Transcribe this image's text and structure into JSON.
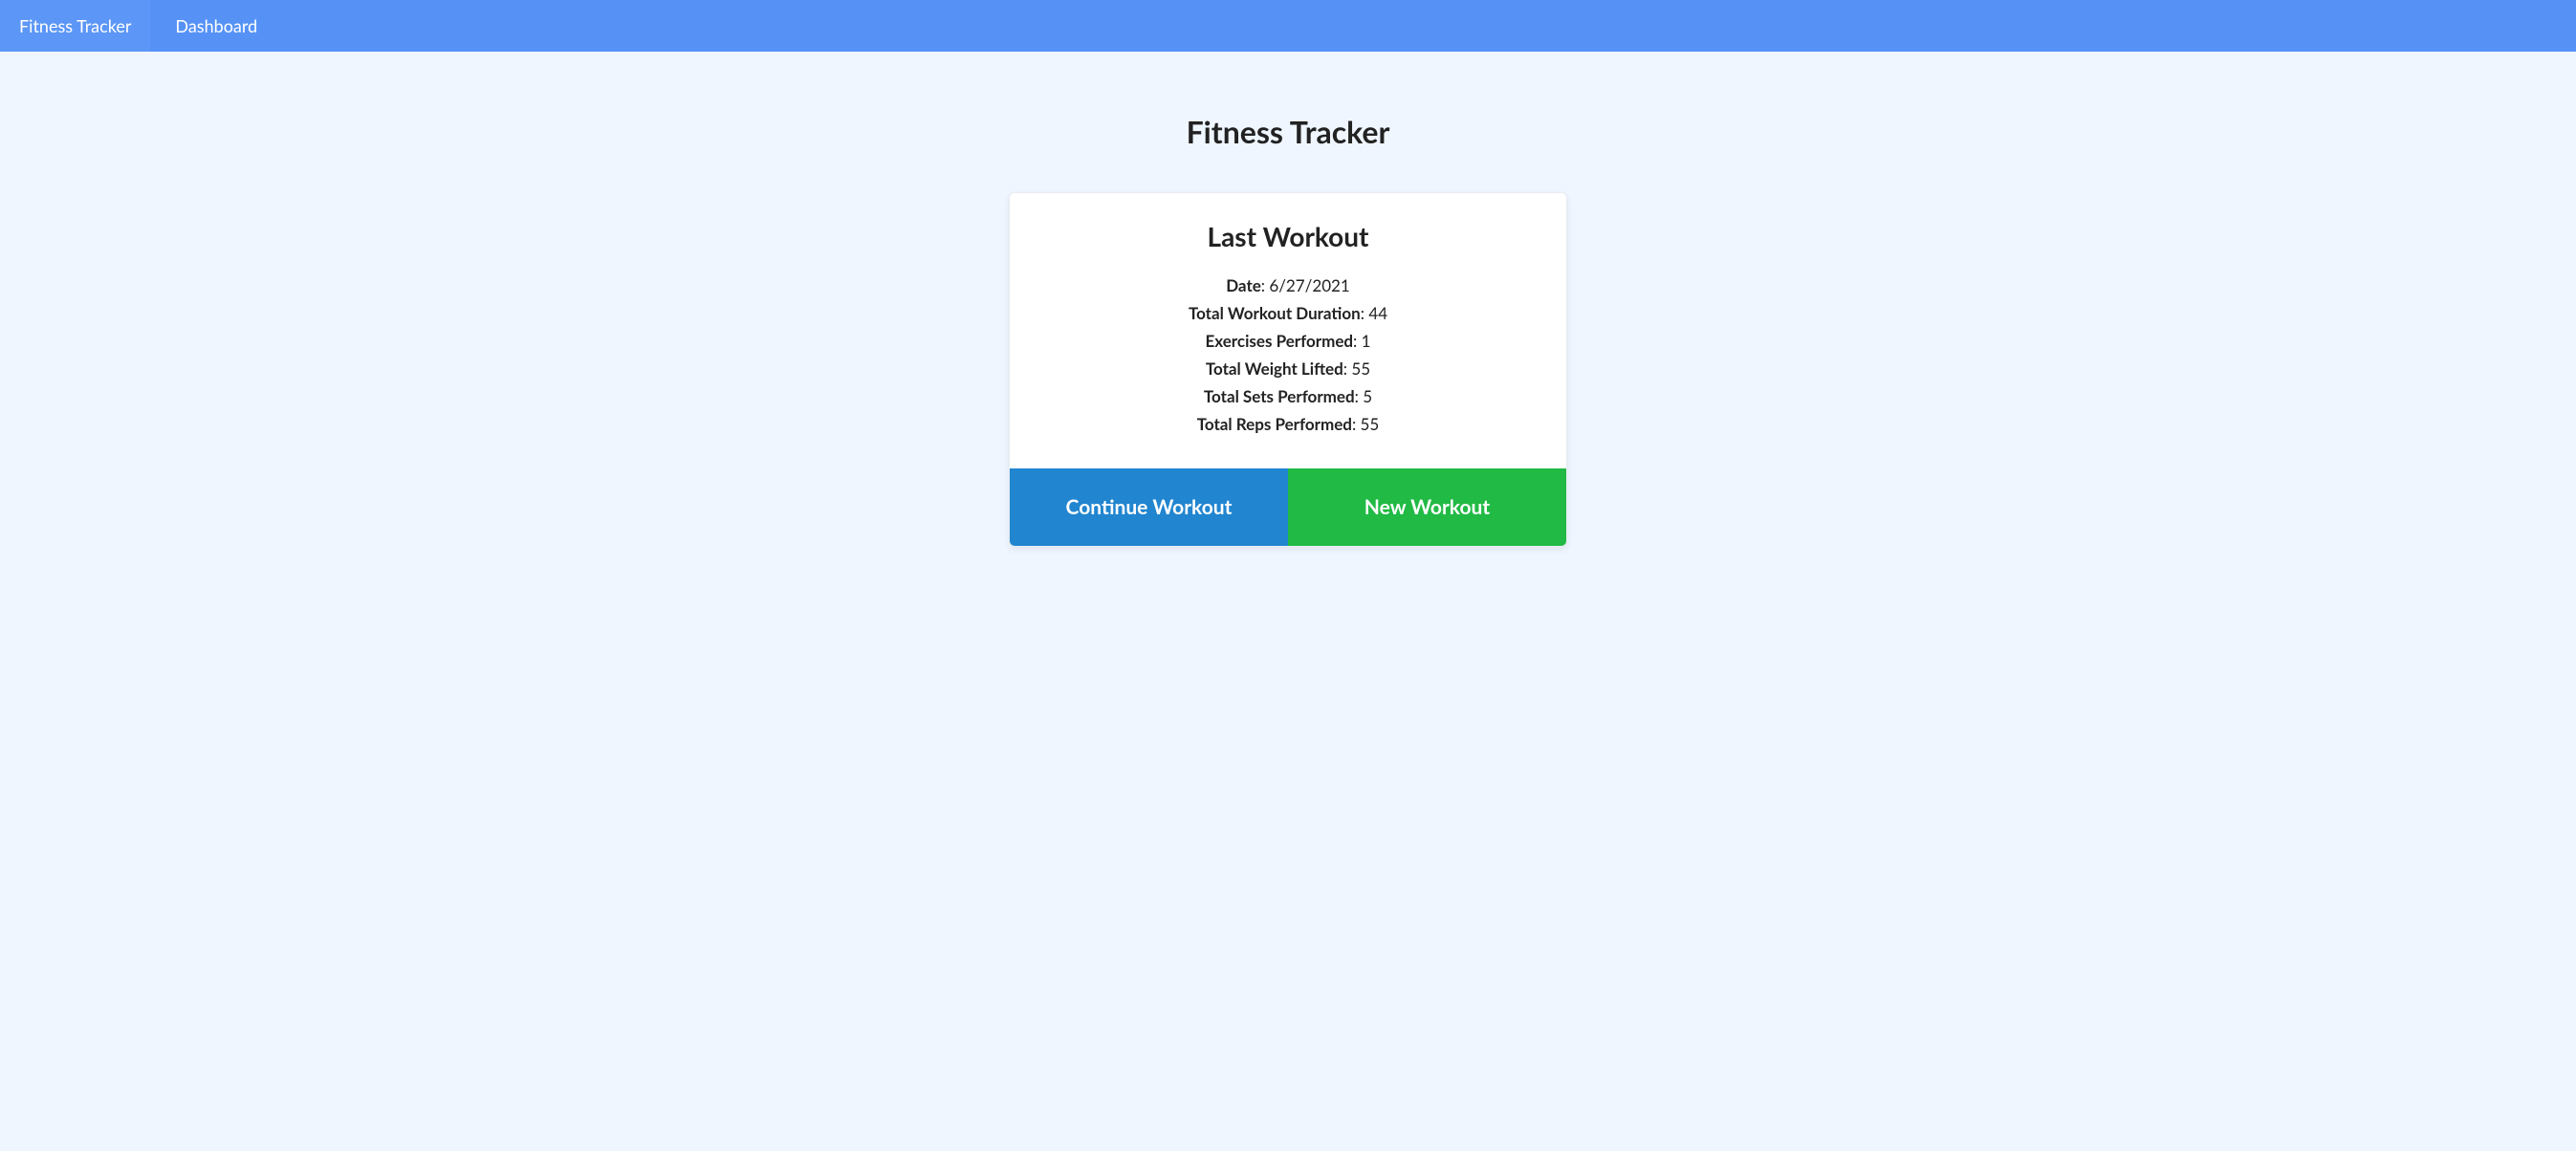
{
  "nav": {
    "brand": "Fitness Tracker",
    "items": [
      {
        "label": "Dashboard"
      }
    ]
  },
  "page": {
    "title": "Fitness Tracker"
  },
  "card": {
    "title": "Last Workout",
    "stats": [
      {
        "label": "Date",
        "value": "6/27/2021"
      },
      {
        "label": "Total Workout Duration",
        "value": "44"
      },
      {
        "label": "Exercises Performed",
        "value": "1"
      },
      {
        "label": "Total Weight Lifted",
        "value": "55"
      },
      {
        "label": "Total Sets Performed",
        "value": "5"
      },
      {
        "label": "Total Reps Performed",
        "value": "55"
      }
    ],
    "continue_label": "Continue Workout",
    "new_label": "New Workout"
  }
}
